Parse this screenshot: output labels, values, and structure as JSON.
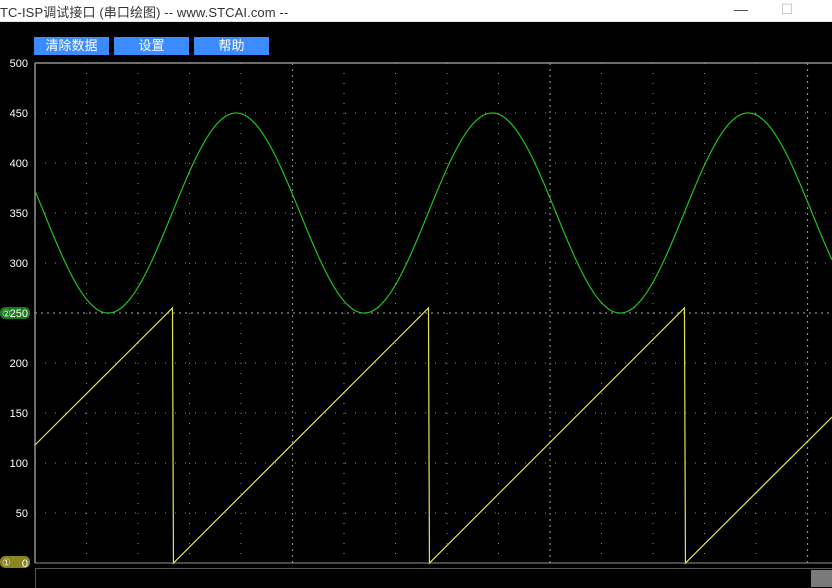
{
  "window": {
    "title": "TC-ISP调试接口 (串口绘图) -- www.STCAI.com --",
    "minimize_glyph": "—",
    "maximize_glyph": "☐"
  },
  "toolbar": {
    "clear_label": "清除数据",
    "settings_label": "设置",
    "help_label": "帮助"
  },
  "channel_markers": {
    "ch2_value": "250",
    "ch1_value": "0",
    "ch2_glyph": "②",
    "ch1_glyph": "①"
  },
  "chart_data": {
    "type": "line",
    "ylim": [
      0,
      500
    ],
    "y_ticks": [
      0,
      50,
      100,
      150,
      200,
      250,
      300,
      350,
      400,
      450,
      500
    ],
    "x_samples": 316,
    "grid": true,
    "series": [
      {
        "kind": "sine",
        "color": "#22c21f",
        "center": 350,
        "amplitude": 100,
        "period_samples": 101.5,
        "first_min_sample": 29,
        "note_values": "min 250, max 450"
      },
      {
        "kind": "sawtooth",
        "color": "#e8e44a",
        "min": 0,
        "max": 255,
        "period_samples": 101.5,
        "first_reset_sample": 54.5,
        "start_value": 118
      }
    ],
    "colors": {
      "axis": "#909090",
      "grid": "#8a8a8a",
      "label": "#ffffff"
    }
  }
}
